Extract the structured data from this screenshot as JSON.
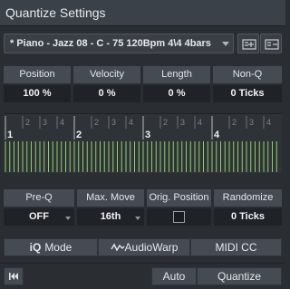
{
  "window": {
    "title": "Quantize Settings"
  },
  "preset": {
    "selected": "* Piano - Jazz 08 - C - 75  120Bpm  4\\4  4bars"
  },
  "params_row1": [
    {
      "label": "Position",
      "value": "100 %"
    },
    {
      "label": "Velocity",
      "value": "0 %"
    },
    {
      "label": "Length",
      "value": "0 %"
    },
    {
      "label": "Non-Q",
      "value": "0 Ticks"
    }
  ],
  "grid": {
    "bar_numbers": [
      "1",
      "2",
      "3",
      "4"
    ],
    "beat_numbers": [
      "2",
      "3",
      "4"
    ]
  },
  "params_row2": [
    {
      "label": "Pre-Q",
      "value": "OFF"
    },
    {
      "label": "Max. Move",
      "value": "16th"
    },
    {
      "label": "Orig. Position",
      "checked": false
    },
    {
      "label": "Randomize",
      "value": "0 Ticks"
    }
  ],
  "bottom_buttons": {
    "mode_icon": "iQ",
    "mode_label": "Mode",
    "audiowarp_label": "AudioWarp",
    "midicc_label": "MIDI CC"
  },
  "footer": {
    "auto_label": "Auto",
    "quantize_label": "Quantize"
  },
  "colors": {
    "accent_grid_lines": "#8fcf6a",
    "panel_bg": "#2a2d32",
    "label_bg": "#454b53",
    "value_bg": "#1f2226"
  },
  "icons": [
    "save-preset-icon",
    "load-preset-icon",
    "skip-to-start-icon",
    "audiowarp-wave-icon"
  ]
}
